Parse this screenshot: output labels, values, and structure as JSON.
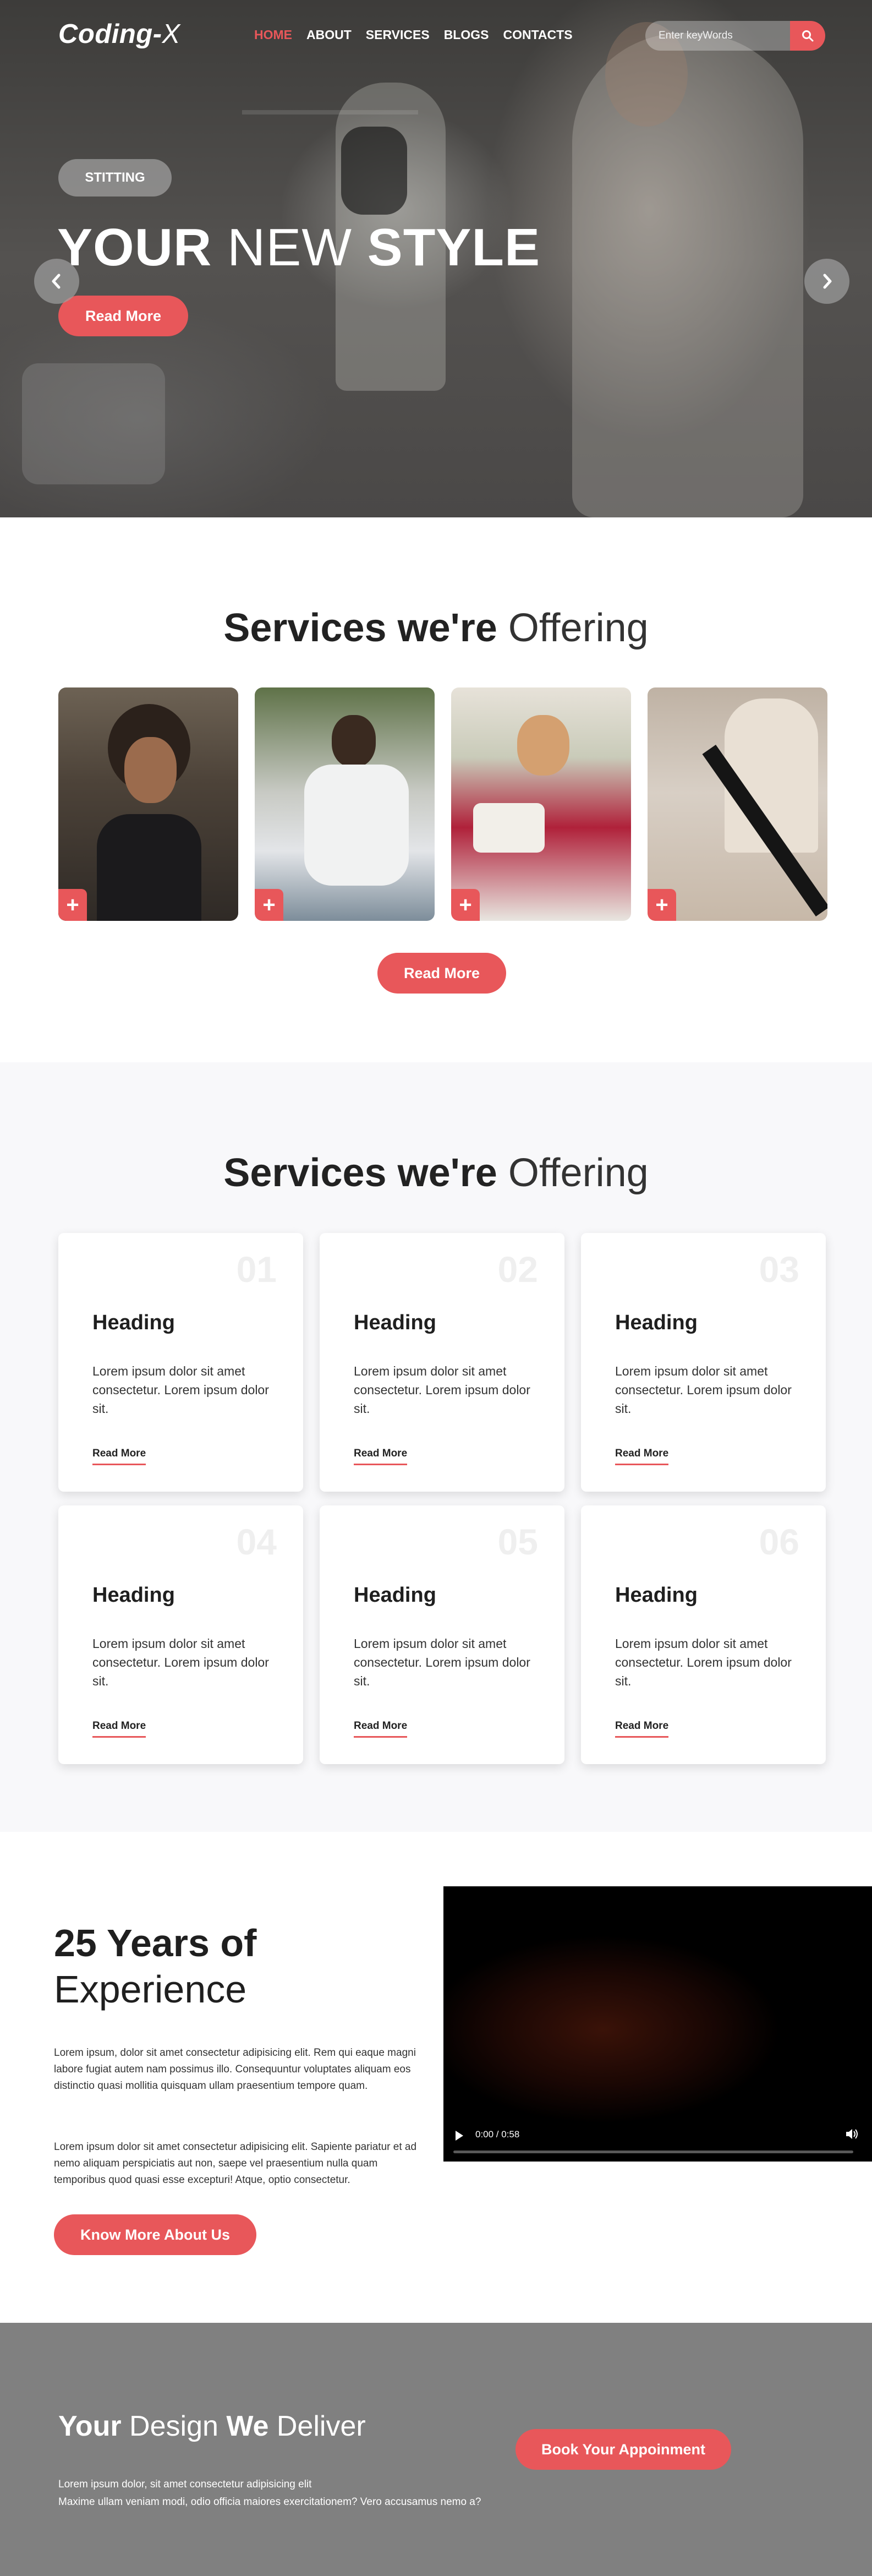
{
  "brand": {
    "logo_main": "Coding-",
    "logo_x": "X"
  },
  "nav": {
    "items": [
      {
        "label": "HOME",
        "active": true
      },
      {
        "label": "ABOUT",
        "active": false
      },
      {
        "label": "SERVICES",
        "active": false
      },
      {
        "label": "BLOGS",
        "active": false
      },
      {
        "label": "CONTACTS",
        "active": false
      }
    ],
    "search_placeholder": "Enter keyWords",
    "search_icon": "search-icon"
  },
  "hero": {
    "tag": "STITTING",
    "title_1": "YOUR",
    "title_2": "NEW",
    "title_3": "STYLE",
    "button": "Read More",
    "prev_icon": "chevron-left-icon",
    "next_icon": "chevron-right-icon"
  },
  "services_gallery": {
    "title_bold": "Services we're",
    "title_light": "Offering",
    "cards": [
      {
        "plus": "+"
      },
      {
        "plus": "+"
      },
      {
        "plus": "+"
      },
      {
        "plus": "+"
      }
    ],
    "button": "Read More"
  },
  "services_list": {
    "title_bold": "Services we're",
    "title_light": "Offering",
    "cards": [
      {
        "num": "01",
        "heading": "Heading",
        "text": "Lorem ipsum dolor sit amet consectetur. Lorem ipsum dolor sit.",
        "link": "Read More"
      },
      {
        "num": "02",
        "heading": "Heading",
        "text": "Lorem ipsum dolor sit amet consectetur. Lorem ipsum dolor sit.",
        "link": "Read More"
      },
      {
        "num": "03",
        "heading": "Heading",
        "text": "Lorem ipsum dolor sit amet consectetur. Lorem ipsum dolor sit.",
        "link": "Read More"
      },
      {
        "num": "04",
        "heading": "Heading",
        "text": "Lorem ipsum dolor sit amet consectetur. Lorem ipsum dolor sit.",
        "link": "Read More"
      },
      {
        "num": "05",
        "heading": "Heading",
        "text": "Lorem ipsum dolor sit amet consectetur. Lorem ipsum dolor sit.",
        "link": "Read More"
      },
      {
        "num": "06",
        "heading": "Heading",
        "text": "Lorem ipsum dolor sit amet consectetur. Lorem ipsum dolor sit.",
        "link": "Read More"
      }
    ]
  },
  "experience": {
    "title_bold": "25 Years of",
    "title_light": "Experience",
    "paragraph_1": "Lorem ipsum, dolor sit amet consectetur adipisicing elit. Rem qui eaque magni labore fugiat autem nam possimus illo. Consequuntur voluptates aliquam eos distinctio quasi mollitia quisquam ullam praesentium tempore quam.",
    "paragraph_2": "Lorem ipsum dolor sit amet consectetur adipisicing elit. Sapiente pariatur et ad nemo aliquam perspiciatis aut non, saepe vel praesentium nulla quam temporibus quod quasi esse excepturi! Atque, optio consectetur.",
    "button": "Know More About Us",
    "video_time": "0:00 / 0:58"
  },
  "cta": {
    "w1": "Your",
    "w2": "Design",
    "w3": "We",
    "w4": "Deliver",
    "line_1": "Lorem ipsum dolor, sit amet consectetur adipisicing elit",
    "line_2": "Maxime ullam veniam modi, odio officia maiores exercitationem? Vero accusamus nemo a?",
    "button": "Book Your Appoinment"
  },
  "colors": {
    "accent": "#e8575a",
    "dark": "#1f1f1f",
    "cta_bg": "#808080",
    "section_bg": "#f8f8fa"
  }
}
